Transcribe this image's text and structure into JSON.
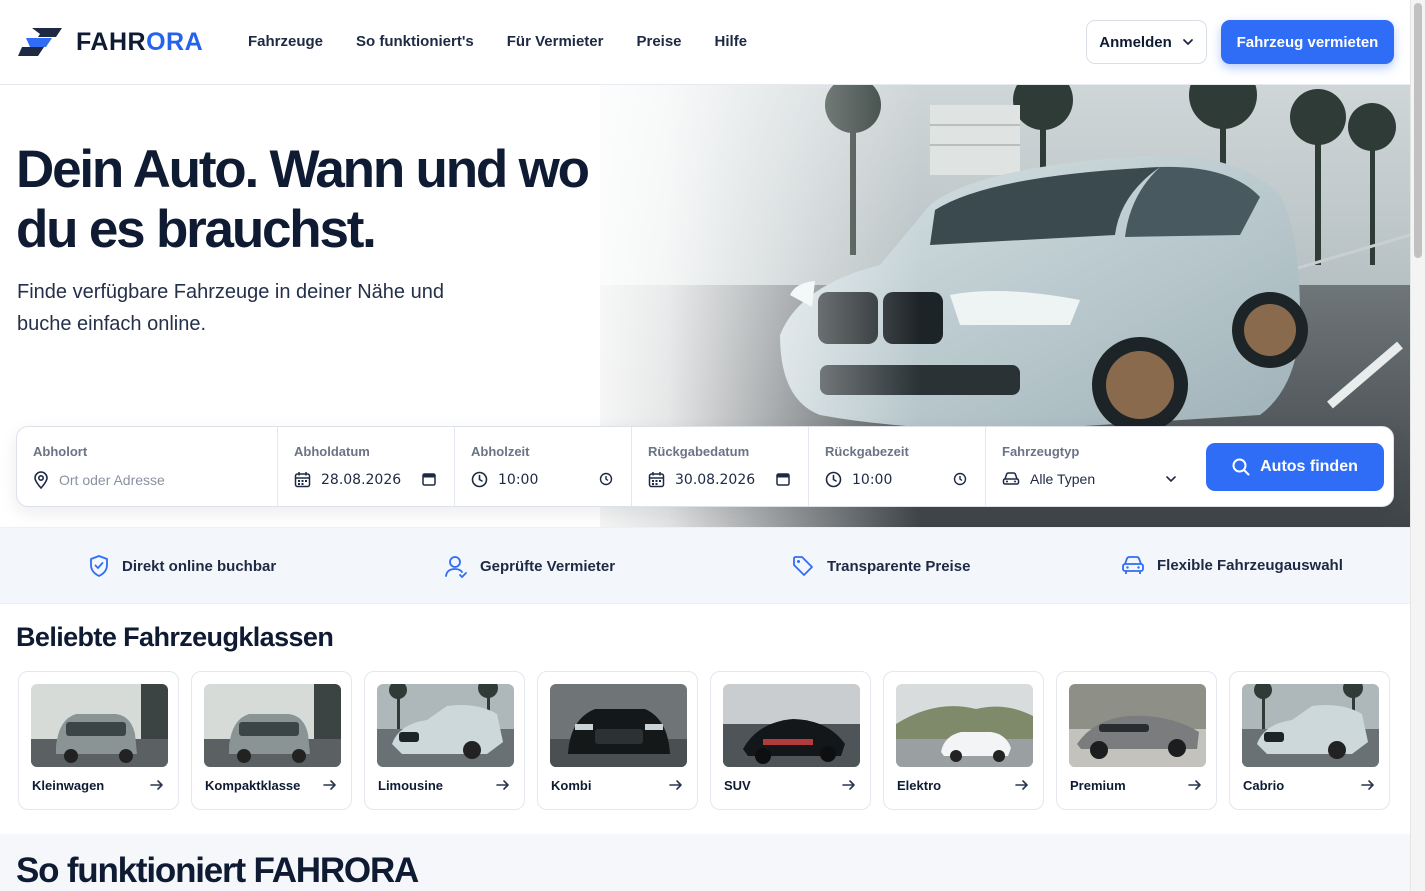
{
  "brand": {
    "name_part1": "FAHR",
    "name_part2": "ORA",
    "accent": "#2563eb"
  },
  "nav": [
    "Fahrzeuge",
    "So funktioniert's",
    "Für Vermieter",
    "Preise",
    "Hilfe"
  ],
  "header": {
    "login_label": "Anmelden",
    "rent_label": "Fahrzeug vermieten"
  },
  "hero": {
    "title": "Dein Auto. Wann und wo du es brauchst.",
    "subtitle": "Finde verfügbare Fahrzeuge in deiner Nähe und buche einfach online."
  },
  "search": {
    "pickup_location": {
      "label": "Abholort",
      "placeholder": "Ort oder Adresse"
    },
    "pickup_date": {
      "label": "Abholdatum",
      "value": "28.08.2026"
    },
    "pickup_time": {
      "label": "Abholzeit",
      "value": "10:00"
    },
    "return_date": {
      "label": "Rückgabedatum",
      "value": "30.08.2026"
    },
    "return_time": {
      "label": "Rückgabezeit",
      "value": "10:00"
    },
    "vehicle_type": {
      "label": "Fahrzeugtyp",
      "value": "Alle Typen"
    },
    "button_label": "Autos finden"
  },
  "features": [
    {
      "label": "Direkt online buchbar",
      "icon": "shield-check-icon"
    },
    {
      "label": "Geprüfte Vermieter",
      "icon": "user-icon"
    },
    {
      "label": "Transparente Preise",
      "icon": "tag-icon"
    },
    {
      "label": "Flexible Fahrzeugauswahl",
      "icon": "car-icon"
    }
  ],
  "classes": {
    "title": "Beliebte Fahrzeugklassen",
    "items": [
      "Kleinwagen",
      "Kompaktklasse",
      "Limousine",
      "Kombi",
      "SUV",
      "Elektro",
      "Premium",
      "Cabrio"
    ]
  },
  "how": {
    "title": "So funktioniert FAHRORA"
  },
  "colors": {
    "primary": "#2f6df6",
    "text": "#0f1b33",
    "muted": "#6b7385"
  }
}
